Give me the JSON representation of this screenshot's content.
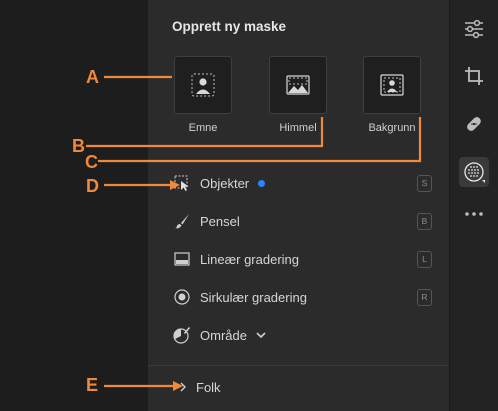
{
  "panel": {
    "title": "Opprett ny maske",
    "tiles": [
      {
        "label": "Emne",
        "icon": "subject-icon"
      },
      {
        "label": "Himmel",
        "icon": "sky-icon"
      },
      {
        "label": "Bakgrunn",
        "icon": "background-icon"
      }
    ],
    "tools": [
      {
        "label": "Objekter",
        "shortcut": "S",
        "icon": "objects-select-icon",
        "has_dot": true
      },
      {
        "label": "Pensel",
        "shortcut": "B",
        "icon": "brush-icon"
      },
      {
        "label": "Lineær gradering",
        "shortcut": "L",
        "icon": "linear-gradient-icon"
      },
      {
        "label": "Sirkulær gradering",
        "shortcut": "R",
        "icon": "radial-gradient-icon"
      },
      {
        "label": "Område",
        "icon": "range-icon"
      }
    ],
    "folk_label": "Folk"
  },
  "callouts": {
    "a": "A",
    "b": "B",
    "c": "C",
    "d": "D",
    "e": "E"
  },
  "colors": {
    "accent": "#f0893a",
    "dot": "#2a85ff"
  }
}
